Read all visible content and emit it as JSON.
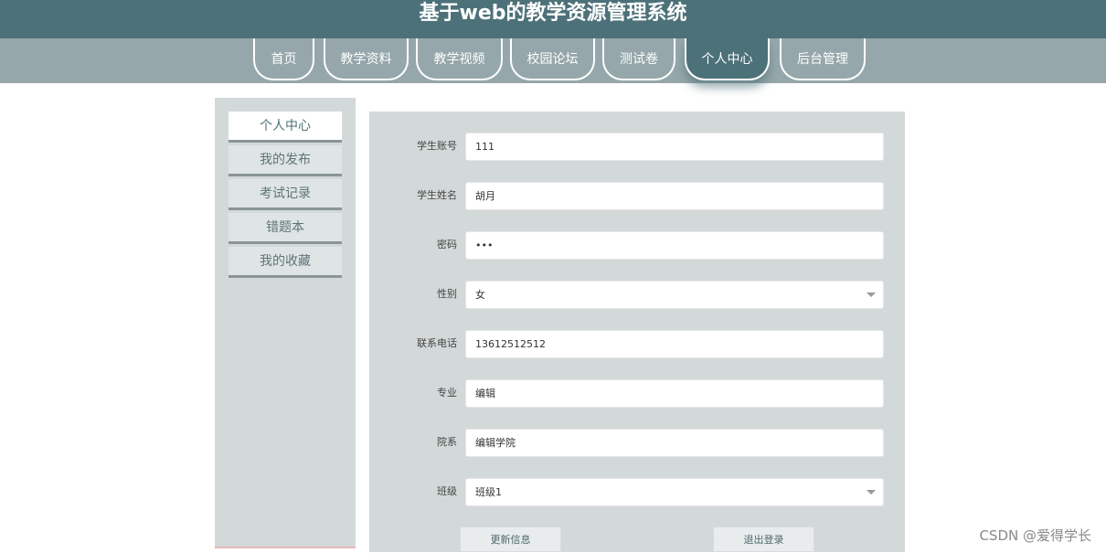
{
  "header": {
    "title": "基于web的教学资源管理系统"
  },
  "nav": {
    "items": [
      {
        "label": "首页"
      },
      {
        "label": "教学资料"
      },
      {
        "label": "教学视频"
      },
      {
        "label": "校园论坛"
      },
      {
        "label": "测试卷"
      },
      {
        "label": "个人中心",
        "active": true
      },
      {
        "label": "后台管理"
      }
    ]
  },
  "sidebar": {
    "items": [
      {
        "label": "个人中心",
        "active": true
      },
      {
        "label": "我的发布"
      },
      {
        "label": "考试记录"
      },
      {
        "label": "错题本"
      },
      {
        "label": "我的收藏"
      }
    ]
  },
  "form": {
    "fields": [
      {
        "label": "学生账号",
        "value": "111"
      },
      {
        "label": "学生姓名",
        "value": "胡月"
      },
      {
        "label": "密码",
        "value": "•••"
      },
      {
        "label": "性别",
        "value": "女"
      },
      {
        "label": "联系电话",
        "value": "13612512512"
      },
      {
        "label": "专业",
        "value": "编辑"
      },
      {
        "label": "院系",
        "value": "编辑学院"
      },
      {
        "label": "班级",
        "value": "班级1"
      }
    ],
    "update_button": "更新信息",
    "logout_button": "退出登录"
  },
  "watermark": "CSDN @爱得学长",
  "colors": {
    "header": "#4d7179",
    "navbar": "#95a7aa",
    "panel": "#d3d9d8"
  }
}
